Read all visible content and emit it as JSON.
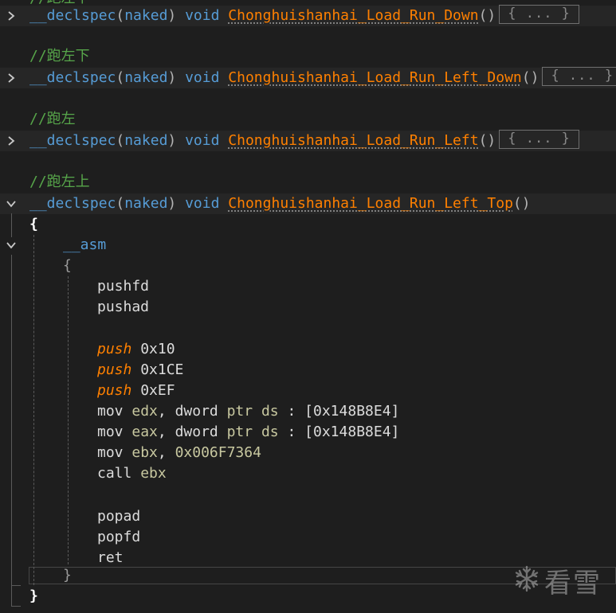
{
  "code": {
    "comment_prefix": "//",
    "comment_top_partial": "//跑左下",
    "decl_prefix": "__declspec",
    "decl_open": "(",
    "decl_naked": "naked",
    "decl_close": ")",
    "void_kw": "void",
    "parens": "()",
    "collapsed_text": "{ ... }",
    "functions": [
      {
        "name": "Chonghuishanhai_Load_Run_Down",
        "comment": "",
        "collapsed": true
      },
      {
        "name": "Chonghuishanhai_Load_Run_Left_Down",
        "comment": "//跑左下",
        "collapsed": true
      },
      {
        "name": "Chonghuishanhai_Load_Run_Left",
        "comment": "//跑左",
        "collapsed": true
      },
      {
        "name": "Chonghuishanhai_Load_Run_Left_Top",
        "comment": "//跑左上",
        "collapsed": false
      }
    ],
    "open_brace": "{",
    "close_brace": "}",
    "asm_kw": "__asm",
    "asm_open": "{",
    "asm_close": "}",
    "body": {
      "l1": "pushfd",
      "l2": "pushad",
      "push_kw": "push",
      "push1": "0x10",
      "push2": "0x1CE",
      "push3": "0xEF",
      "mov_kw": "mov",
      "edx": "edx",
      "eax": "eax",
      "ebx": "ebx",
      "comma": ",",
      "dword": "dword",
      "ptr": "ptr",
      "ds": "ds",
      "colon": ":",
      "addr1": "[0x148B8E4]",
      "addr2": "[0x148B8E4]",
      "imm": "0x006F7364",
      "call_kw": "call",
      "popad": "popad",
      "popfd": "popfd",
      "ret": "ret"
    }
  },
  "watermark": {
    "text": "看雪",
    "icon": "snowflake-icon"
  },
  "colors": {
    "background": "#1e1e1e",
    "keyword": "#569cd6",
    "function": "#ff8000",
    "comment": "#57a64a",
    "register": "#c8c8a0"
  }
}
